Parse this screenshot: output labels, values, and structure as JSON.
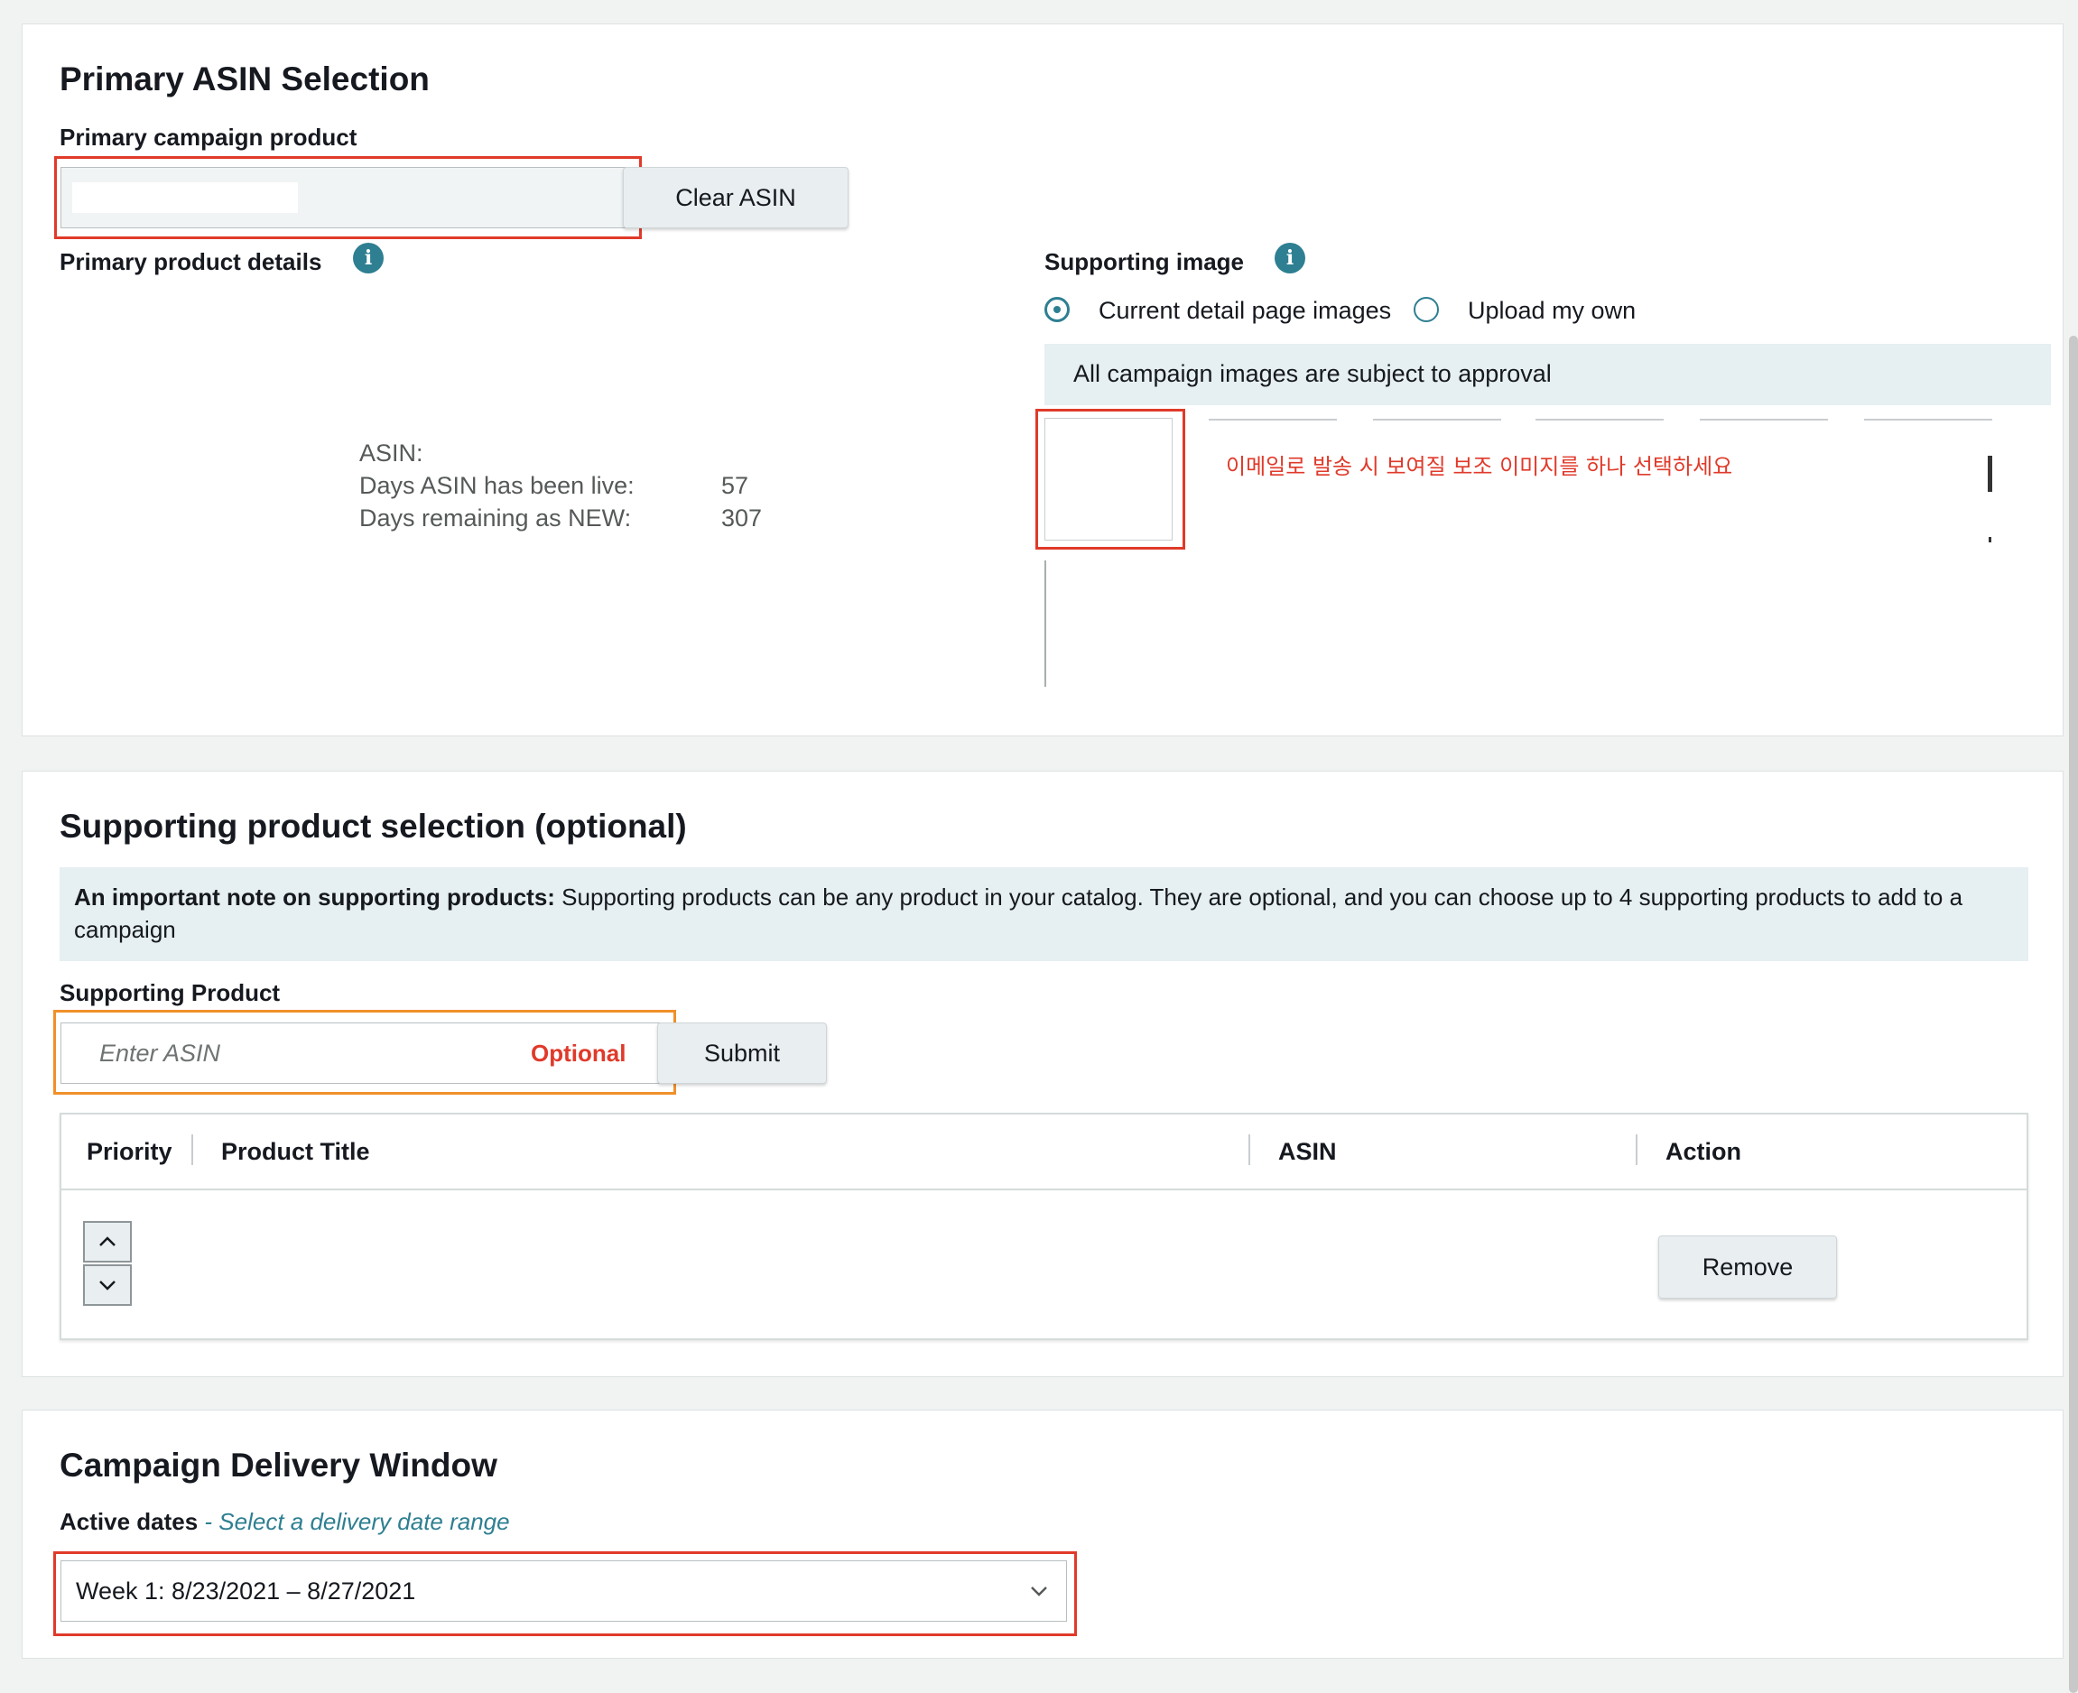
{
  "primary": {
    "heading": "Primary ASIN Selection",
    "campaign_product_label": "Primary campaign product",
    "clear_button": "Clear ASIN",
    "details_label": "Primary product details",
    "asin_label": "ASIN:",
    "days_live_label": "Days ASIN has been live:",
    "days_live_value": "57",
    "days_remaining_label": "Days remaining as NEW:",
    "days_remaining_value": "307",
    "supporting_image_label": "Supporting image",
    "radio_current": "Current detail page images",
    "radio_upload": "Upload my own",
    "approval_note": "All campaign images are subject to approval",
    "korean_annotation": "이메일로 발송 시 보여질 보조 이미지를 하나 선택하세요"
  },
  "supporting": {
    "heading": "Supporting product selection (optional)",
    "note_bold": "An important note on supporting products:",
    "note_text": " Supporting products can be any product in your catalog. They are optional, and you can choose up to 4 supporting products to add to a",
    "note_text2": "campaign",
    "product_label": "Supporting Product",
    "input_placeholder": "Enter ASIN",
    "optional_tag": "Optional",
    "submit_button": "Submit",
    "table": {
      "col_priority": "Priority",
      "col_title": "Product Title",
      "col_asin": "ASIN",
      "col_action": "Action",
      "remove_button": "Remove"
    }
  },
  "delivery": {
    "heading": "Campaign Delivery Window",
    "active_dates_label": "Active dates",
    "active_dates_hint": " - Select a delivery date range",
    "selected_week": "Week 1: 8/23/2021 – 8/27/2021"
  },
  "colors": {
    "highlight_red": "#e03a2a",
    "highlight_orange": "#f0902a",
    "accent_teal": "#2e7f91",
    "note_bg": "#e6eff1"
  },
  "icons": [
    "info-icon",
    "radio-selected-icon",
    "radio-unselected-icon",
    "chevron-up-icon",
    "chevron-down-icon"
  ]
}
